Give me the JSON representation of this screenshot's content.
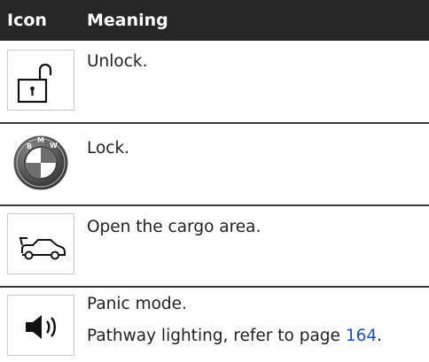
{
  "header": {
    "icon_col": "Icon",
    "meaning_col": "Meaning"
  },
  "rows": [
    {
      "icon": "unlock-icon",
      "meaning": "Unlock."
    },
    {
      "icon": "bmw-logo-lock-icon",
      "meaning": "Lock."
    },
    {
      "icon": "car-trunk-icon",
      "meaning": "Open the cargo area."
    },
    {
      "icon": "horn-speaker-icon",
      "meaning": "Panic mode.",
      "meaning_line2_prefix": "Pathway lighting, refer to page ",
      "meaning_line2_link": "164",
      "meaning_line2_suffix": "."
    }
  ],
  "colors": {
    "header_bg": "#262626",
    "link": "#1a4fc0"
  }
}
